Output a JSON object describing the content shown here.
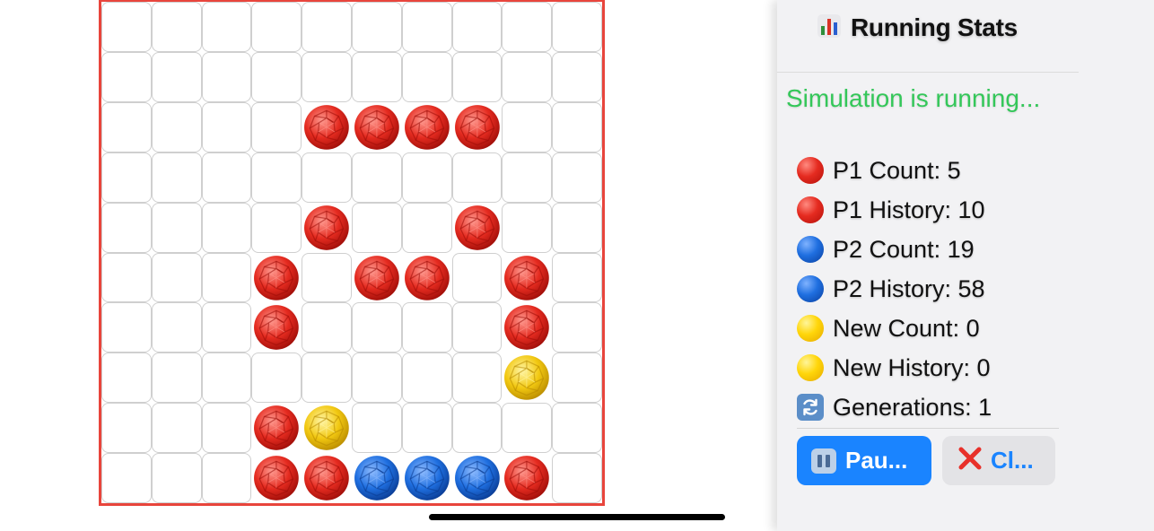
{
  "board": {
    "rows": 10,
    "cols": 10,
    "border_color": "#e8453c",
    "cells": [
      [
        2,
        4,
        "red"
      ],
      [
        2,
        5,
        "red"
      ],
      [
        2,
        6,
        "red"
      ],
      [
        2,
        7,
        "red"
      ],
      [
        4,
        4,
        "red"
      ],
      [
        4,
        7,
        "red"
      ],
      [
        5,
        3,
        "red"
      ],
      [
        5,
        5,
        "red"
      ],
      [
        5,
        6,
        "red"
      ],
      [
        5,
        8,
        "red"
      ],
      [
        6,
        3,
        "red"
      ],
      [
        6,
        8,
        "red"
      ],
      [
        7,
        8,
        "yellow"
      ],
      [
        8,
        3,
        "red"
      ],
      [
        8,
        4,
        "yellow"
      ],
      [
        9,
        3,
        "red"
      ],
      [
        9,
        4,
        "red"
      ],
      [
        9,
        5,
        "blue"
      ],
      [
        9,
        6,
        "blue"
      ],
      [
        9,
        7,
        "blue"
      ],
      [
        9,
        8,
        "red"
      ]
    ],
    "colors": {
      "red": "#e52b20",
      "blue": "#1f6fe0",
      "yellow": "#ffd60a"
    }
  },
  "panel": {
    "title": "Running Stats",
    "title_icon": "bar-chart-icon",
    "status": "Simulation is running...",
    "status_color": "#34c759",
    "stats": [
      {
        "icon": "red-circle-icon",
        "color": "red",
        "label": "P1 Count: 5"
      },
      {
        "icon": "red-circle-icon",
        "color": "red",
        "label": "P1 History: 10"
      },
      {
        "icon": "blue-circle-icon",
        "color": "blue",
        "label": "P2 Count: 19"
      },
      {
        "icon": "blue-circle-icon",
        "color": "blue",
        "label": "P2 History: 58"
      },
      {
        "icon": "yellow-circle-icon",
        "color": "yellow",
        "label": "New Count: 0"
      },
      {
        "icon": "yellow-circle-icon",
        "color": "yellow",
        "label": "New History: 0"
      },
      {
        "icon": "refresh-icon",
        "color": "refresh",
        "label": "Generations: 1"
      }
    ],
    "pause_label": "Pau...",
    "clear_label": "Cl...",
    "accent_color": "#1a84ff"
  }
}
